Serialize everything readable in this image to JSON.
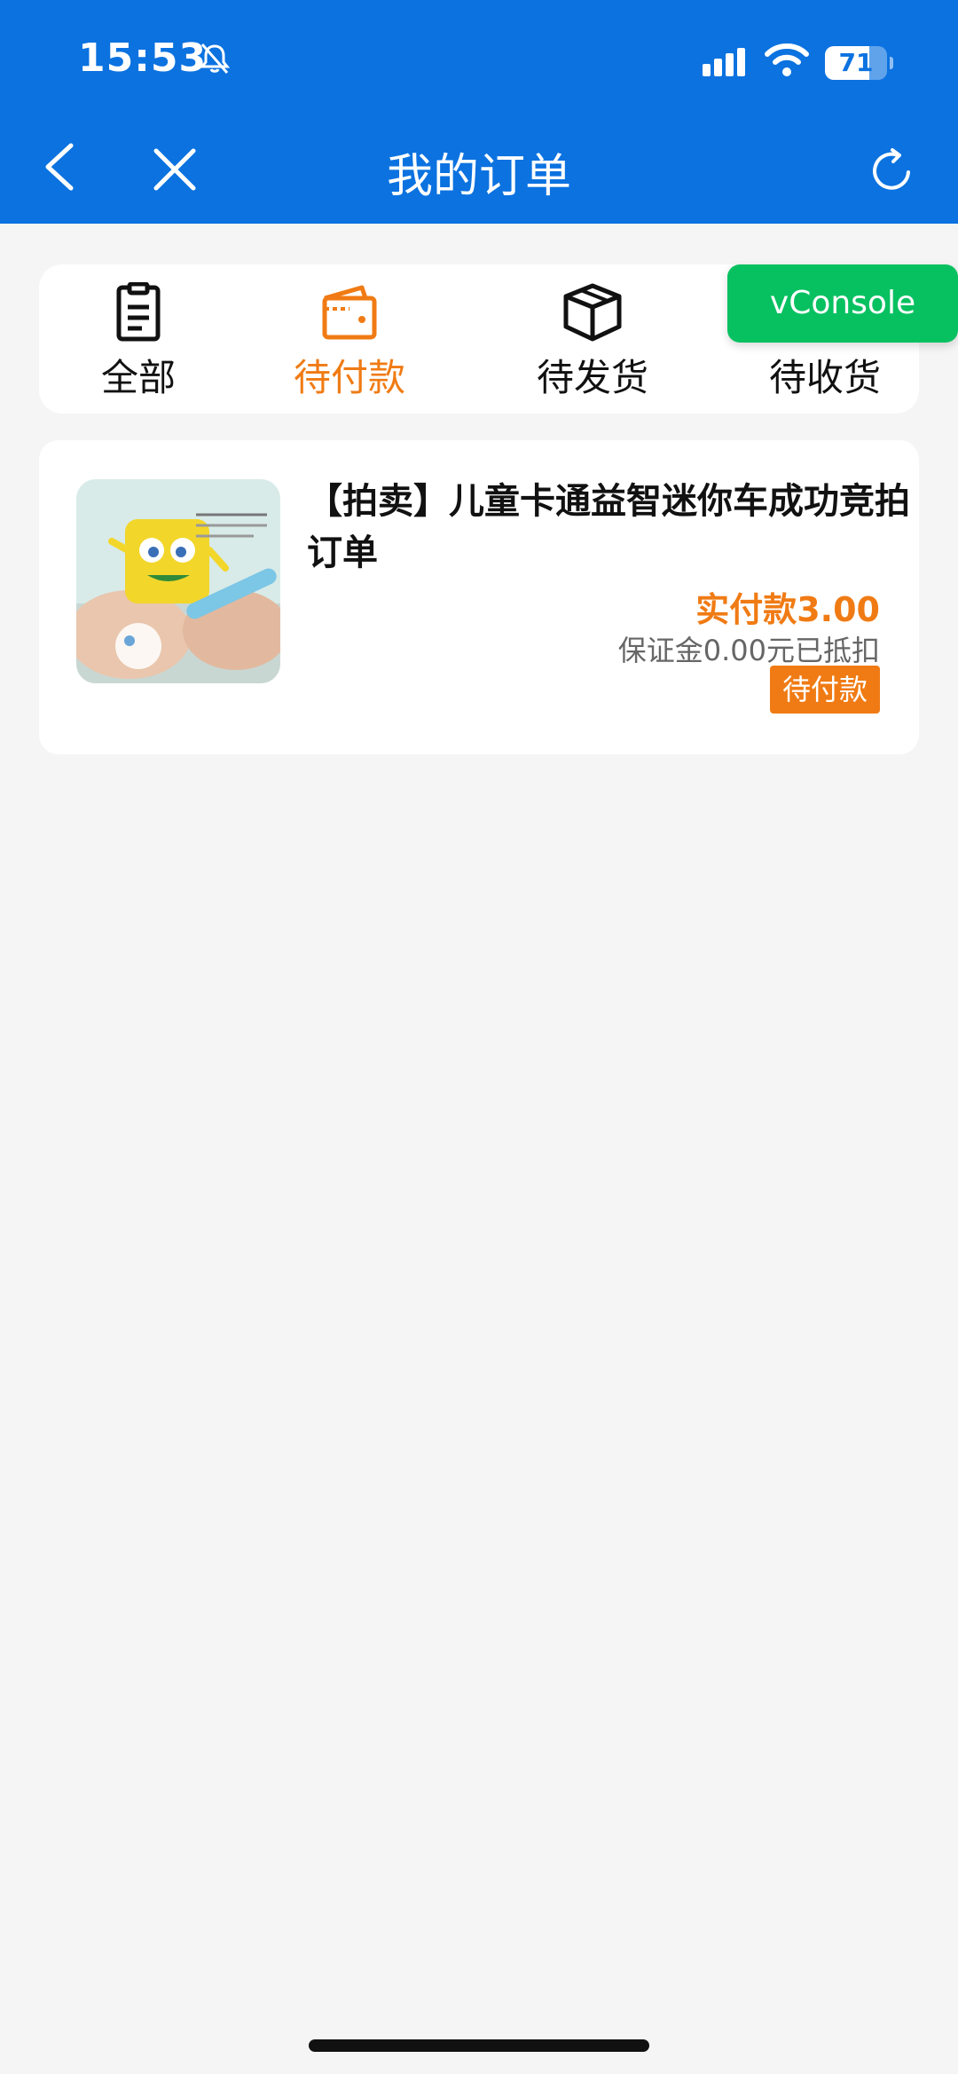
{
  "status_bar": {
    "time": "15:53",
    "battery": "71",
    "battery_level": 0.71
  },
  "nav": {
    "title": "我的订单"
  },
  "tabs": [
    {
      "label": "全部",
      "icon": "clipboard-icon",
      "active": false
    },
    {
      "label": "待付款",
      "icon": "wallet-icon",
      "active": true
    },
    {
      "label": "待发货",
      "icon": "package-icon",
      "active": false
    },
    {
      "label": "待收货",
      "icon": "truck-icon",
      "active": false
    }
  ],
  "vconsole": {
    "label": "vConsole"
  },
  "order": {
    "title": "【拍卖】儿童卡通益智迷你车成功竞拍订单",
    "price": "实付款3.00",
    "deposit": "保证金0.00元已抵扣",
    "status": "待付款"
  },
  "colors": {
    "header": "#0b72e0",
    "accent": "#f07b14",
    "vconsole": "#07c160",
    "background": "#f5f5f5"
  }
}
